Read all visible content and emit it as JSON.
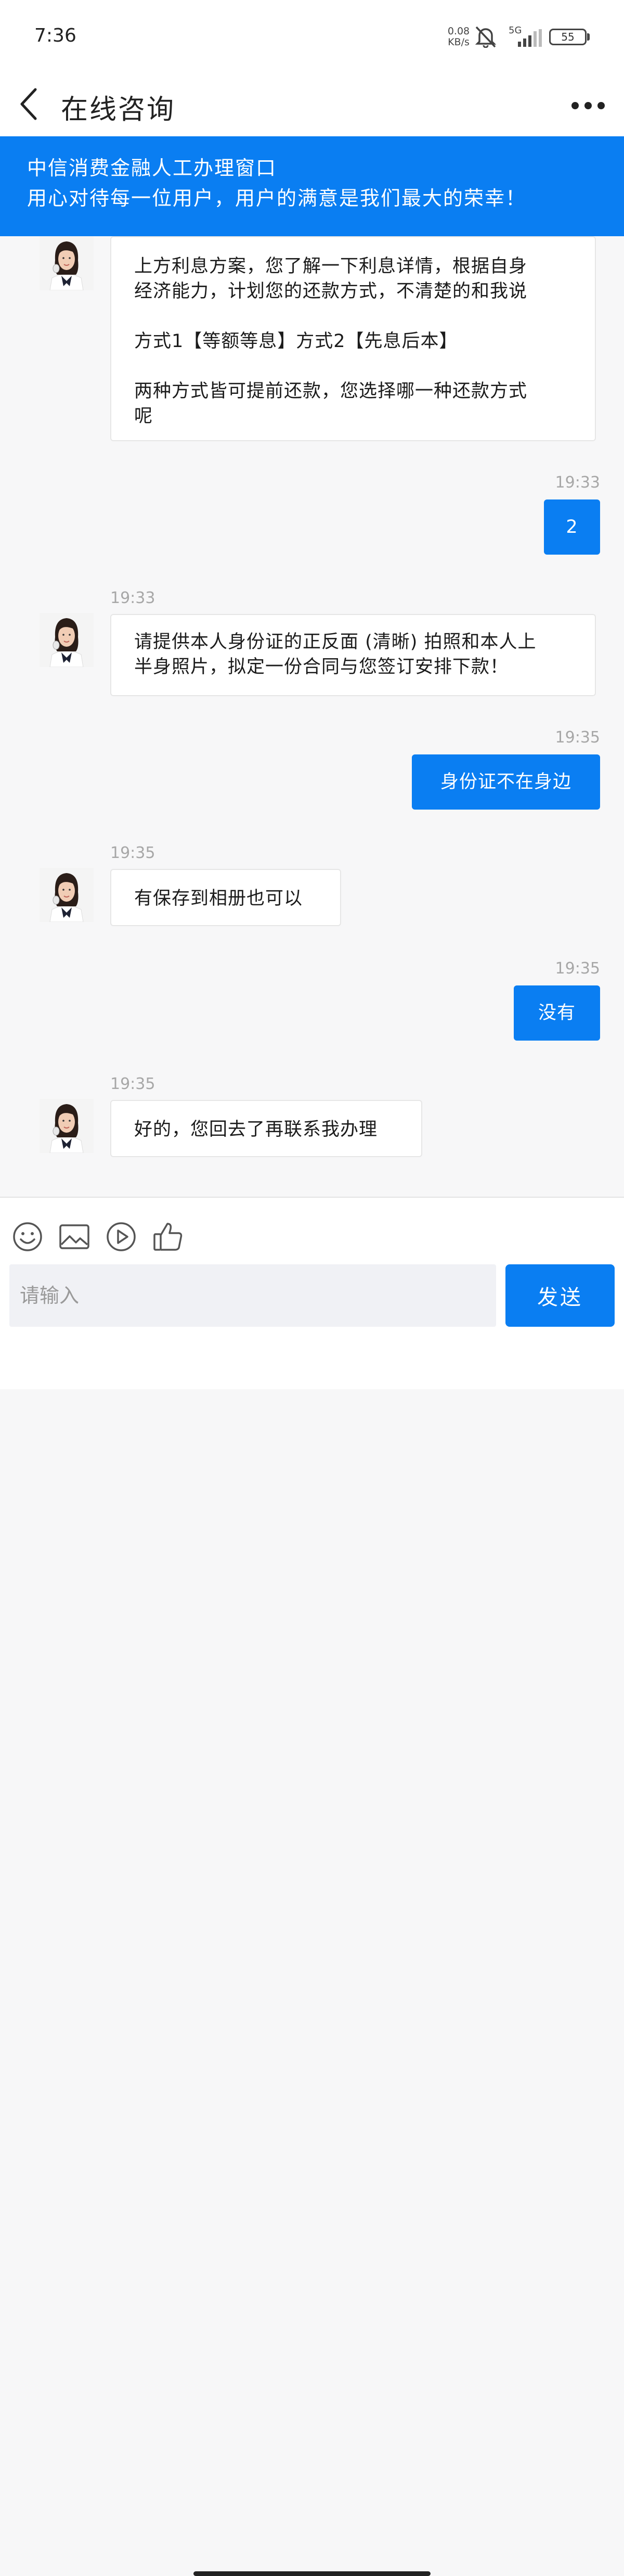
{
  "status_bar": {
    "time": "7:36",
    "net_speed_value": "0.08",
    "net_speed_unit": "KB/s",
    "signal_label": "5G",
    "battery": "55"
  },
  "nav": {
    "title": "在线咨询"
  },
  "banner": {
    "line1": "中信消费金融人工办理窗口",
    "line2": "用心对待每一位用户，用户的满意是我们最大的荣幸！"
  },
  "messages": [
    {
      "side": "in",
      "time": "",
      "lines": [
        "上方利息方案，您了解一下利息详情，根据自身",
        "经济能力，计划您的还款方式，不清楚的和我说",
        "",
        "方式1【等额等息】方式2【先息后本】",
        "",
        "两种方式皆可提前还款，您选择哪一种还款方式",
        "呢"
      ]
    },
    {
      "side": "out",
      "time": "19:33",
      "text": "2"
    },
    {
      "side": "in",
      "time": "19:33",
      "lines": [
        "请提供本人身份证的正反面 (清晰) 拍照和本人上",
        "半身照片，拟定一份合同与您签订安排下款！"
      ]
    },
    {
      "side": "out",
      "time": "19:35",
      "text": "身份证不在身边"
    },
    {
      "side": "in",
      "time": "19:35",
      "lines": [
        "有保存到相册也可以"
      ]
    },
    {
      "side": "out",
      "time": "19:35",
      "text": "没有"
    },
    {
      "side": "in",
      "time": "19:35",
      "lines": [
        "好的，您回去了再联系我办理"
      ]
    }
  ],
  "input": {
    "placeholder": "请输入",
    "send_label": "发送",
    "tools": [
      "emoji-icon",
      "image-icon",
      "video-play-icon",
      "thumbs-up-icon"
    ]
  },
  "colors": {
    "accent": "#0a7ef2",
    "background": "#f7f7f8",
    "bubble_in": "#ffffff",
    "timestamp": "#a7a7a7"
  }
}
